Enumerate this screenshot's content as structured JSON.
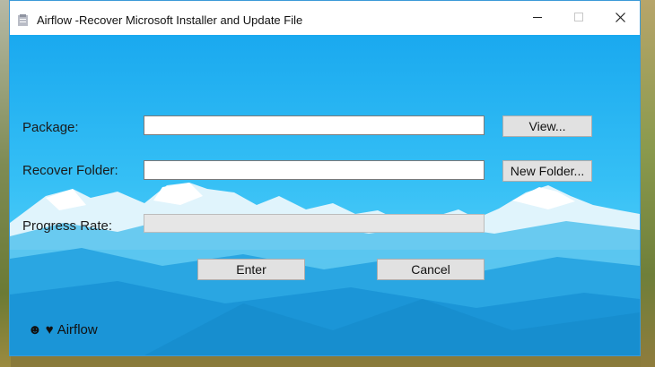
{
  "window": {
    "title": "Airflow -Recover Microsoft Installer and Update File",
    "controls": {
      "minimize": "—",
      "maximize": "☐",
      "close": "✕"
    }
  },
  "form": {
    "package_label": "Package:",
    "package_value": "",
    "view_button": "View...",
    "recover_folder_label": "Recover Folder:",
    "recover_folder_value": "",
    "new_folder_button": "New Folder...",
    "progress_label": "Progress Rate:",
    "progress_value": 0,
    "enter_button": "Enter",
    "cancel_button": "Cancel"
  },
  "footer": {
    "smiley_icon": "☻",
    "heart_icon": "♥",
    "text": "Airflow"
  },
  "colors": {
    "window_border": "#3b9ad8",
    "sky_top": "#1aa9ef",
    "sky_bottom": "#4fcdf7",
    "button_face": "#e1e1e1"
  }
}
